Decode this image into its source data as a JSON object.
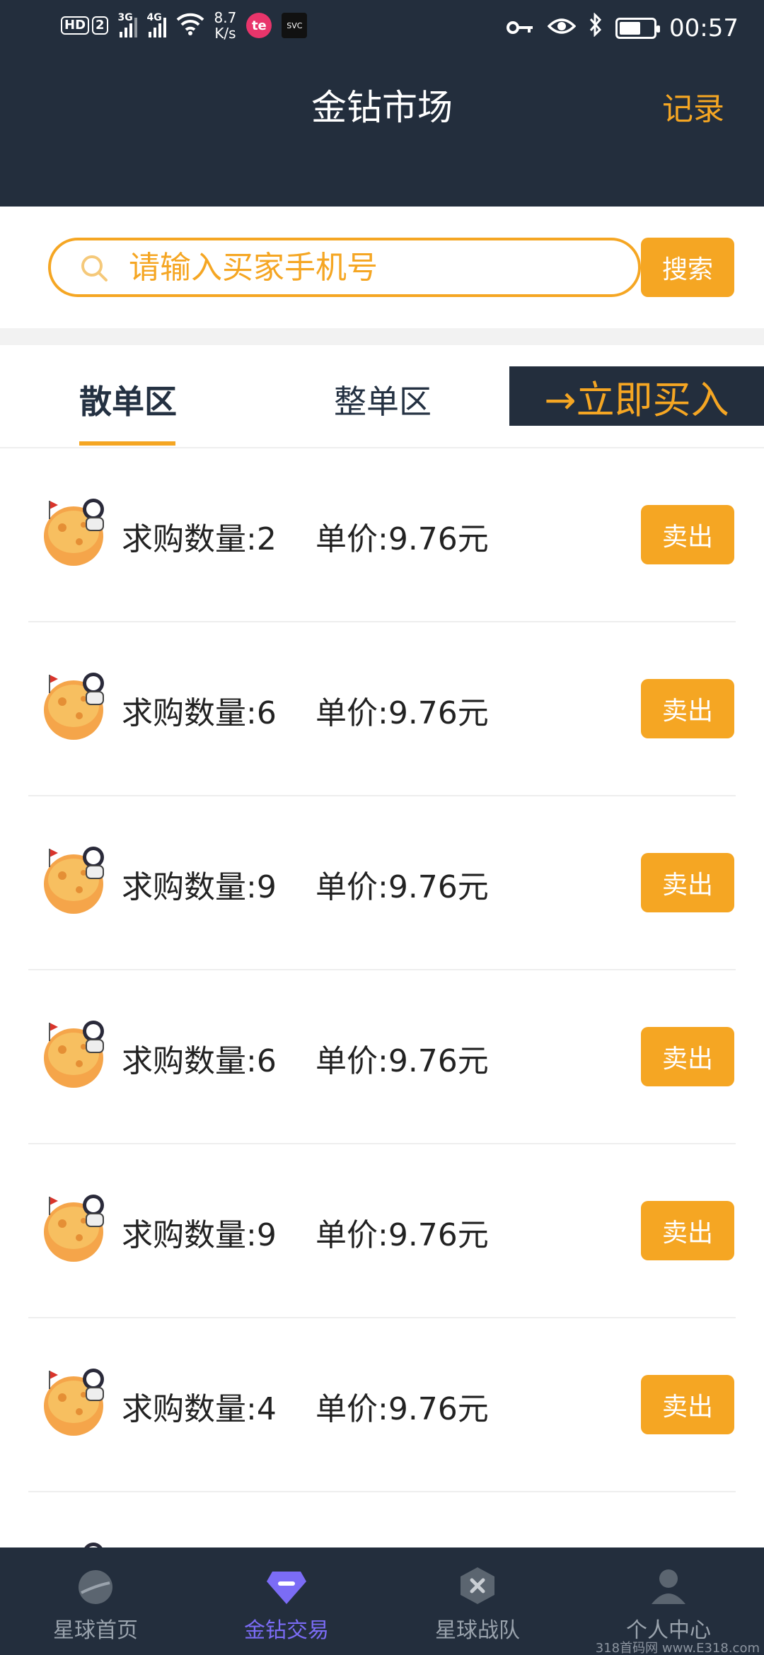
{
  "status_bar": {
    "hd_badge": "HD",
    "sim_badge": "2",
    "net1": "3G",
    "net2": "4G",
    "speed_value": "8.7",
    "speed_unit": "K/s",
    "te_label": "te",
    "svc_label": "SVC",
    "time": "00:57",
    "battery_level": 0.55
  },
  "header": {
    "title": "金钻市场",
    "record_label": "记录"
  },
  "search": {
    "placeholder": "请输入买家手机号",
    "button_label": "搜索"
  },
  "tabs": {
    "active_label": "散单区",
    "inactive_label": "整单区",
    "buy_now_label": "→立即买入"
  },
  "orders": [
    {
      "qty_label": "求购数量:2",
      "price_label": "单价:9.76元",
      "sell_label": "卖出"
    },
    {
      "qty_label": "求购数量:6",
      "price_label": "单价:9.76元",
      "sell_label": "卖出"
    },
    {
      "qty_label": "求购数量:9",
      "price_label": "单价:9.76元",
      "sell_label": "卖出"
    },
    {
      "qty_label": "求购数量:6",
      "price_label": "单价:9.76元",
      "sell_label": "卖出"
    },
    {
      "qty_label": "求购数量:9",
      "price_label": "单价:9.76元",
      "sell_label": "卖出"
    },
    {
      "qty_label": "求购数量:4",
      "price_label": "单价:9.76元",
      "sell_label": "卖出"
    }
  ],
  "bottom_nav": [
    {
      "label": "星球首页",
      "icon": "planet-icon",
      "active": false
    },
    {
      "label": "金钻交易",
      "icon": "diamond-icon",
      "active": true
    },
    {
      "label": "星球战队",
      "icon": "team-icon",
      "active": false
    },
    {
      "label": "个人中心",
      "icon": "user-icon",
      "active": false
    }
  ],
  "watermark": "318首码网 www.E318.com",
  "colors": {
    "accent": "#f5a623",
    "header_bg": "#232e3d",
    "nav_active": "#7b6cf6",
    "nav_inactive": "#9aa3ad"
  }
}
